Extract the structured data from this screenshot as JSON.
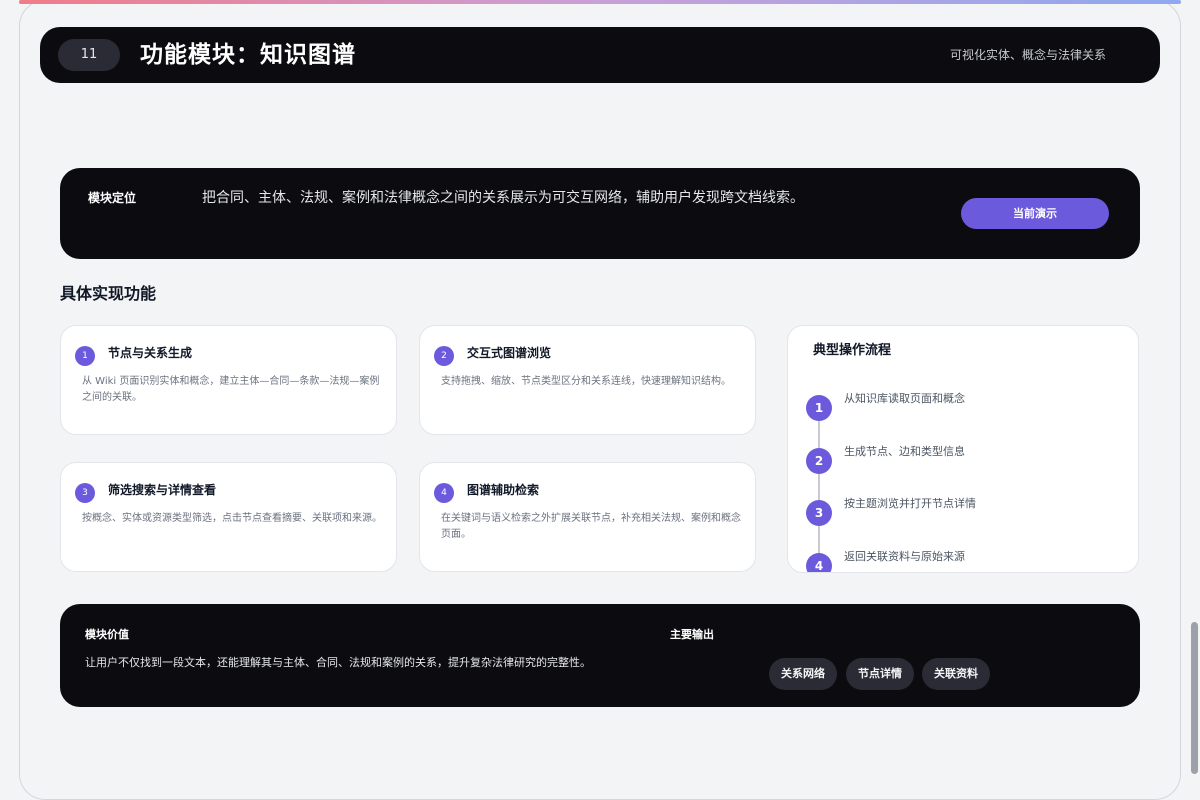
{
  "header": {
    "page_number": "11",
    "title": "功能模块：知识图谱",
    "subtitle": "可视化实体、概念与法律关系"
  },
  "positioning": {
    "label": "模块定位",
    "text": "把合同、主体、法规、案例和法律概念之间的关系展示为可交互网络，辅助用户发现跨文档线索。",
    "button_label": "当前演示"
  },
  "features_title": "具体实现功能",
  "features": [
    {
      "num": "1",
      "title": "节点与关系生成",
      "desc": "从 Wiki 页面识别实体和概念，建立主体—合同—条款—法规—案例之间的关联。"
    },
    {
      "num": "2",
      "title": "交互式图谱浏览",
      "desc": "支持拖拽、缩放、节点类型区分和关系连线，快速理解知识结构。"
    },
    {
      "num": "3",
      "title": "筛选搜索与详情查看",
      "desc": "按概念、实体或资源类型筛选，点击节点查看摘要、关联项和来源。"
    },
    {
      "num": "4",
      "title": "图谱辅助检索",
      "desc": "在关键词与语义检索之外扩展关联节点，补充相关法规、案例和概念页面。"
    }
  ],
  "flow": {
    "title": "典型操作流程",
    "steps": [
      {
        "num": "1",
        "text": "从知识库读取页面和概念"
      },
      {
        "num": "2",
        "text": "生成节点、边和类型信息"
      },
      {
        "num": "3",
        "text": "按主题浏览并打开节点详情"
      },
      {
        "num": "4",
        "text": "返回关联资料与原始来源"
      }
    ]
  },
  "value": {
    "label": "模块价值",
    "text": "让用户不仅找到一段文本，还能理解其与主体、合同、法规和案例的关系，提升复杂法律研究的完整性。"
  },
  "outputs": {
    "label": "主要输出",
    "tags": [
      "关系网络",
      "节点详情",
      "关联资料"
    ]
  },
  "colors": {
    "accent": "#6b5bdc",
    "dark_panel": "#0b0b10",
    "background": "#f3f4f6"
  }
}
